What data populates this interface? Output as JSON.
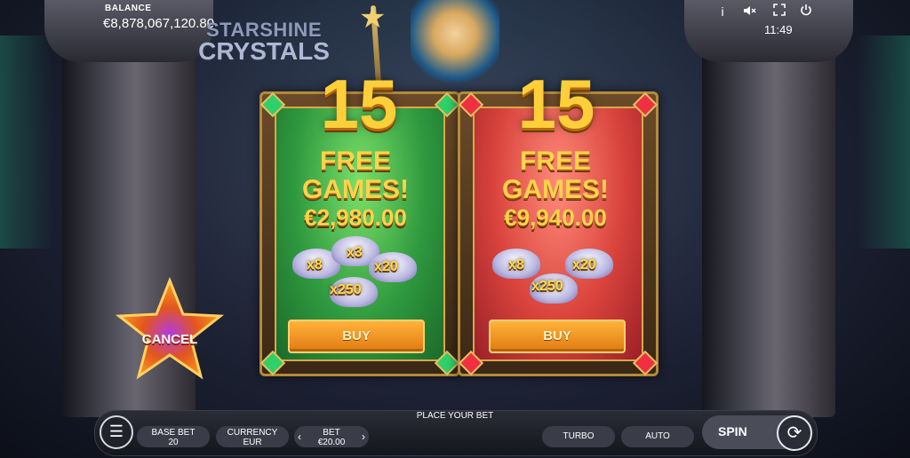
{
  "hud": {
    "balance_label": "BALANCE",
    "balance_value": "€8,878,067,120.80",
    "clock": "11:49",
    "icons": [
      "info-icon",
      "sound-off-icon",
      "fullscreen-icon",
      "power-icon"
    ]
  },
  "logo": {
    "line1": "STARSHINE",
    "line2": "CRYSTALS"
  },
  "offers": [
    {
      "spins": "15",
      "line1": "FREE",
      "line2": "GAMES!",
      "price": "€2,980.00",
      "multipliers": [
        "x8",
        "x3",
        "x20",
        "x250"
      ],
      "buy_label": "BUY",
      "color": "#2f9a3f"
    },
    {
      "spins": "15",
      "line1": "FREE",
      "line2": "GAMES!",
      "price": "€9,940.00",
      "multipliers": [
        "x8",
        "x20",
        "x250"
      ],
      "buy_label": "BUY",
      "color": "#d9433c"
    }
  ],
  "cancel_label": "CANCEL",
  "bottom_bar": {
    "place_bet": "PLACE YOUR BET",
    "base_bet_label": "BASE BET",
    "base_bet_value": "20",
    "currency_label": "CURRENCY",
    "currency_value": "EUR",
    "bet_label": "BET",
    "bet_value": "€20.00",
    "turbo_label": "TURBO",
    "auto_label": "AUTO",
    "spin_label": "SPIN"
  }
}
